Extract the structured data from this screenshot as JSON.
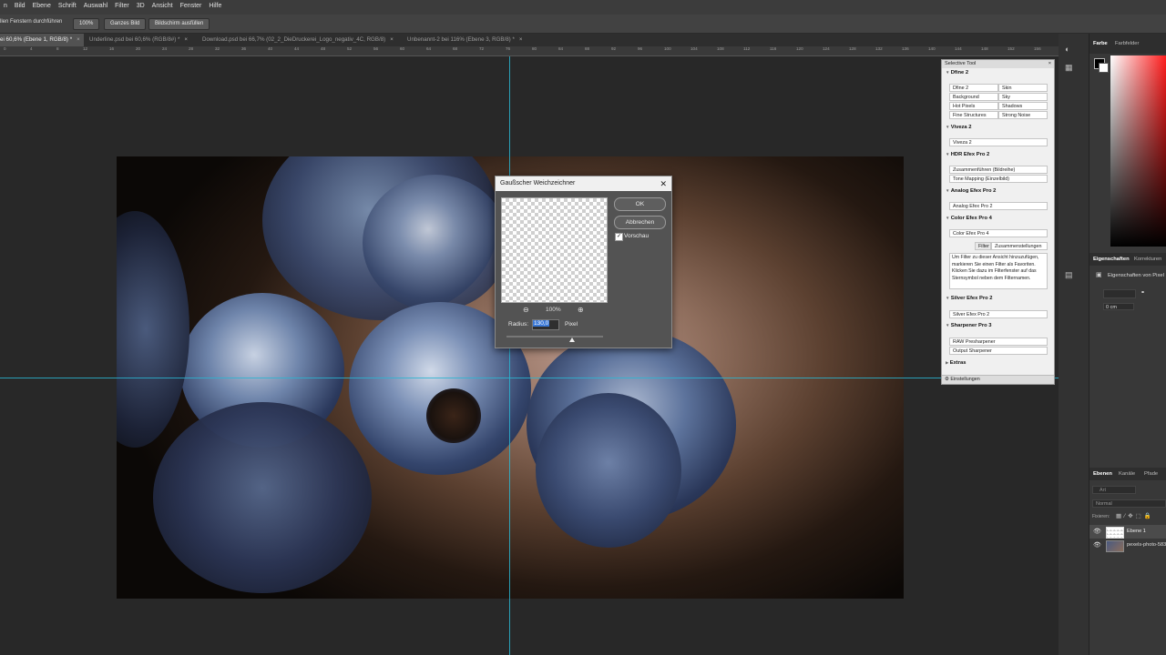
{
  "menu": [
    "n",
    "Bild",
    "Ebene",
    "Schrift",
    "Auswahl",
    "Filter",
    "3D",
    "Ansicht",
    "Fenster",
    "Hilfe"
  ],
  "options": {
    "scroll_all": "llen Fenstern durchführen",
    "zoom100": "100%",
    "fit": "Ganzes Bild",
    "fill": "Bildschirm ausfüllen"
  },
  "tabs": [
    {
      "label": "ei 60,6% (Ebene 1, RGB/8) *",
      "active": true
    },
    {
      "label": "Underline.psd bei 60,6% (RGB/8#) *",
      "active": false
    },
    {
      "label": "Download.psd bei 66,7% (02_2_DieDruckerei_Logo_negativ_4C, RGB/8)",
      "active": false
    },
    {
      "label": "Unbenannt-2 bei 116% (Ebene 3, RGB/8) *",
      "active": false
    }
  ],
  "ruler_ticks": [
    "0",
    "4",
    "8",
    "12",
    "16",
    "20",
    "24",
    "28",
    "32",
    "36",
    "40",
    "44",
    "48",
    "52",
    "56",
    "60",
    "64",
    "68",
    "72",
    "76",
    "80",
    "84",
    "88",
    "92",
    "96",
    "100",
    "104",
    "108",
    "112",
    "116",
    "120",
    "124",
    "128",
    "132",
    "136",
    "140",
    "144",
    "148",
    "152",
    "156"
  ],
  "dialog": {
    "title": "Gaußscher Weichzeichner",
    "ok": "OK",
    "cancel": "Abbrechen",
    "preview_label": "Vorschau",
    "preview_checked": true,
    "zoom": "100%",
    "radius_label": "Radius:",
    "radius_value": "130,0",
    "unit": "Pixel",
    "slider_fraction": 0.68
  },
  "selective_tool": {
    "title": "Selective Tool",
    "dfine": {
      "name": "Dfine 2",
      "buttons": [
        "Dfine 2",
        "Skin",
        "Background",
        "Sky",
        "Hot Pixels",
        "Shadows",
        "Fine Structures",
        "Strong Noise"
      ]
    },
    "viveza": {
      "name": "Viveza 2",
      "button": "Viveza 2"
    },
    "hdr": {
      "name": "HDR Efex Pro 2",
      "buttons": [
        "Zusammenführen (Bildreihe)",
        "Tone Mapping (Einzelbild)"
      ]
    },
    "analog": {
      "name": "Analog Efex Pro 2",
      "button": "Analog Efex Pro 2"
    },
    "color": {
      "name": "Color Efex Pro 4",
      "button": "Color Efex Pro 4",
      "tab_filter": "Filter",
      "tab_combine": "Zusammenstellungen",
      "info": "Um Filter zu dieser Ansicht hinzuzufügen, markieren Sie einen Filter als Favoriten. Klicken Sie dazu im Filterfenster auf das Sternsymbol neben dem Filternamen."
    },
    "silver": {
      "name": "Silver Efex Pro 2",
      "button": "Silver Efex Pro 2"
    },
    "sharpener": {
      "name": "Sharpener Pro 3",
      "buttons": [
        "RAW Presharpener",
        "Output Sharpener"
      ]
    },
    "extras": "Extras",
    "settings": "Einstellungen"
  },
  "panels": {
    "color_tabs": [
      "Farbe",
      "Farbfelder"
    ],
    "props_tabs": [
      "Eigenschaften",
      "Korrekturen"
    ],
    "props_title": "Eigenschaften von Pixel",
    "props_unit": "0 cm",
    "layers_tabs": [
      "Ebenen",
      "Kanäle",
      "Pfade"
    ],
    "layers_search": "Art",
    "blend_mode": "Normal",
    "lock_label": "Fixieren:",
    "layers": [
      {
        "name": "Ebene 1",
        "selected": true
      },
      {
        "name": "pexels-photo-583",
        "selected": false
      }
    ]
  },
  "colors": {
    "guide": "#2ab5d1",
    "accent": "#3a78d6"
  }
}
